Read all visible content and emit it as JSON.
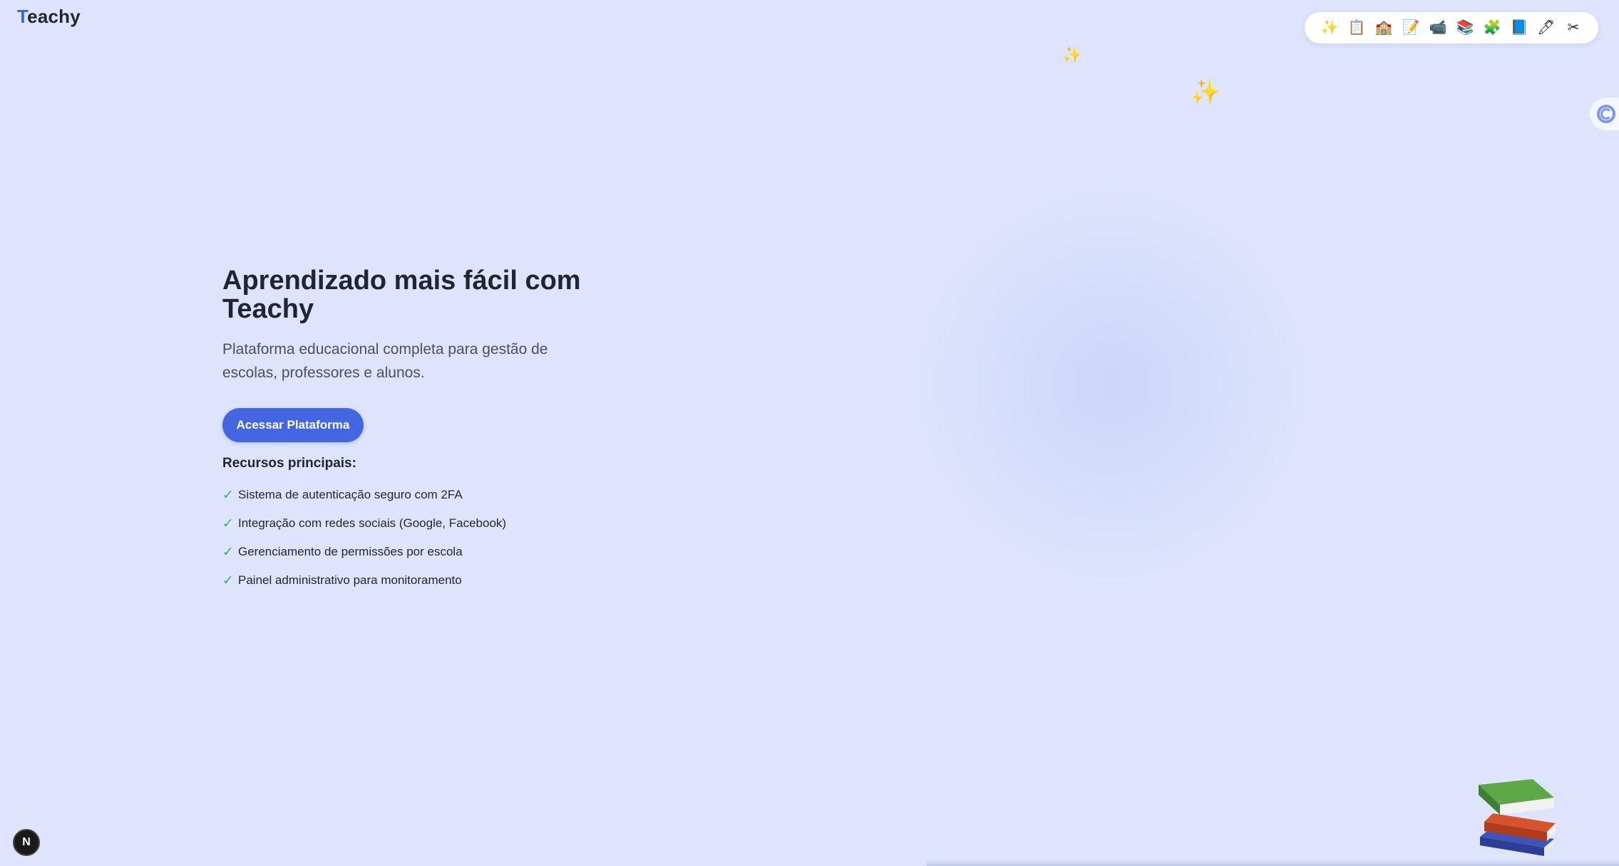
{
  "brand": {
    "first_letter": "T",
    "rest": "eachy"
  },
  "toolbar": {
    "icons": [
      {
        "name": "sparkles-icon",
        "glyph": "✨"
      },
      {
        "name": "clipboard-icon",
        "glyph": "📋"
      },
      {
        "name": "school-icon",
        "glyph": "🏫"
      },
      {
        "name": "memo-icon",
        "glyph": "📝"
      },
      {
        "name": "video-camera-icon",
        "glyph": "📹"
      },
      {
        "name": "books-icon",
        "glyph": "📚"
      },
      {
        "name": "puzzle-icon",
        "glyph": "🧩"
      },
      {
        "name": "blue-book-icon",
        "glyph": "📘"
      },
      {
        "name": "pen-icon",
        "glyph": "🖊"
      },
      {
        "name": "scissors-icon",
        "glyph": "✂"
      }
    ]
  },
  "decor": {
    "sparkle_small": "✨",
    "sparkle_large": "✨"
  },
  "hero": {
    "title": "Aprendizado mais fácil com Teachy",
    "subtitle": "Plataforma educacional completa para gestão de escolas, professores e alunos.",
    "cta_label": "Acessar Plataforma"
  },
  "features": {
    "title": "Recursos principais:",
    "check_glyph": "✓",
    "items": [
      "Sistema de autenticação seguro com 2FA",
      "Integração com redes sociais (Google, Facebook)",
      "Gerenciamento de permissões por escola",
      "Painel administrativo para monitoramento"
    ]
  },
  "dev_badge": {
    "label": "N"
  },
  "colors": {
    "background": "#dde4fb",
    "accent": "#4466e2",
    "check": "#37b36a",
    "text": "#1f2533"
  }
}
